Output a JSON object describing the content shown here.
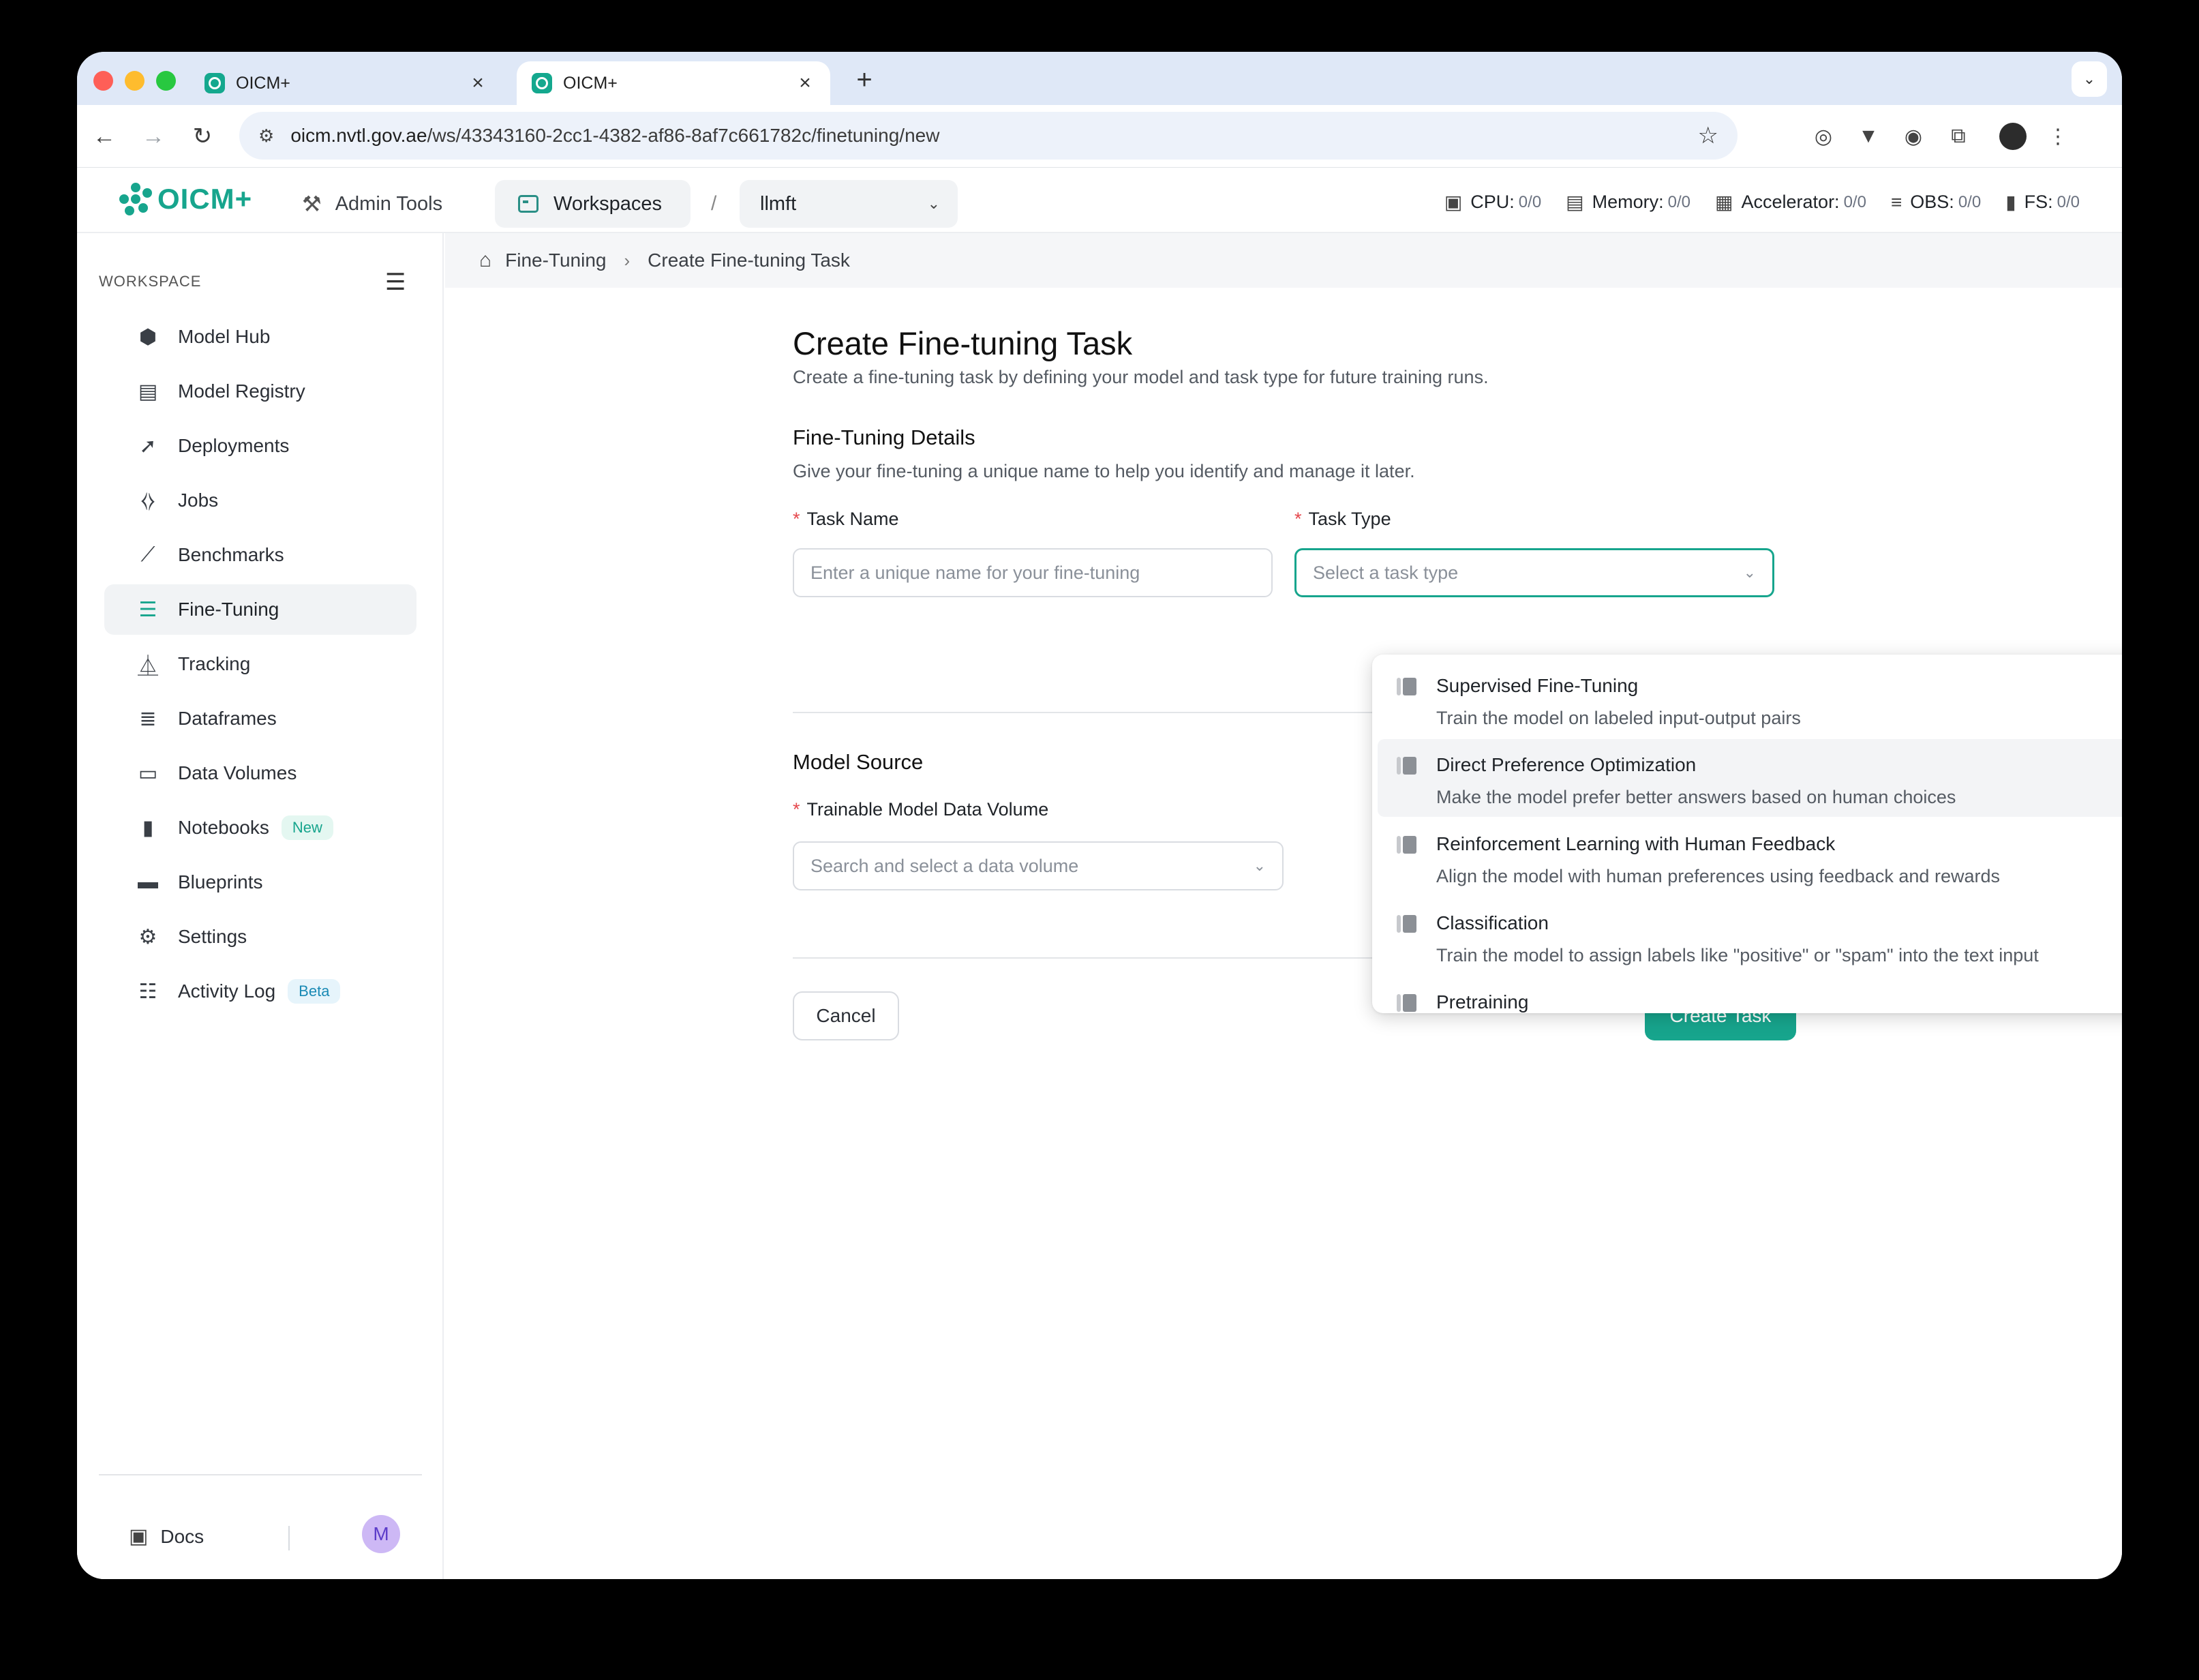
{
  "browser": {
    "tabs": [
      {
        "title": "OICM+",
        "active": false
      },
      {
        "title": "OICM+",
        "active": true
      }
    ],
    "url_host": "oicm.nvtl.gov.ae",
    "url_path": "/ws/43343160-2cc1-4382-af86-8af7c661782c/finetuning/new"
  },
  "header": {
    "logo_text": "OICM+",
    "admin_tools": "Admin Tools",
    "workspaces": "Workspaces",
    "separator": "/",
    "project": "llmft",
    "resources": [
      {
        "icon": "cpu-icon",
        "label": "CPU:",
        "value": "0/0"
      },
      {
        "icon": "memory-icon",
        "label": "Memory:",
        "value": "0/0"
      },
      {
        "icon": "accelerator-icon",
        "label": "Accelerator:",
        "value": "0/0"
      },
      {
        "icon": "obs-icon",
        "label": "OBS:",
        "value": "0/0"
      },
      {
        "icon": "fs-icon",
        "label": "FS:",
        "value": "0/0"
      }
    ]
  },
  "sidebar": {
    "section_label": "WORKSPACE",
    "items": [
      {
        "label": "Model Hub",
        "icon": "cube-icon"
      },
      {
        "label": "Model Registry",
        "icon": "registry-icon"
      },
      {
        "label": "Deployments",
        "icon": "rocket-icon"
      },
      {
        "label": "Jobs",
        "icon": "code-icon"
      },
      {
        "label": "Benchmarks",
        "icon": "benchmark-icon"
      },
      {
        "label": "Fine-Tuning",
        "icon": "sliders-icon",
        "active": true
      },
      {
        "label": "Tracking",
        "icon": "flask-icon"
      },
      {
        "label": "Dataframes",
        "icon": "database-icon"
      },
      {
        "label": "Data Volumes",
        "icon": "volumes-icon"
      },
      {
        "label": "Notebooks",
        "icon": "notebook-icon",
        "badge": "New"
      },
      {
        "label": "Blueprints",
        "icon": "blueprint-icon"
      },
      {
        "label": "Settings",
        "icon": "gear-icon"
      },
      {
        "label": "Activity Log",
        "icon": "list-icon",
        "badge": "Beta"
      }
    ],
    "docs": "Docs",
    "avatar_initial": "M"
  },
  "breadcrumb": {
    "parent": "Fine-Tuning",
    "current": "Create Fine-tuning Task"
  },
  "form": {
    "title": "Create Fine-tuning Task",
    "subtitle": "Create a fine-tuning task by defining your model and task type for future training runs.",
    "details_title": "Fine-Tuning Details",
    "details_subtitle": "Give your fine-tuning a unique name to help you identify and manage it later.",
    "required_mark": "*",
    "task_name_label": "Task Name",
    "task_name_placeholder": "Enter a unique name for your fine-tuning",
    "task_type_label": "Task Type",
    "task_type_placeholder": "Select a task type",
    "model_source_title": "Model Source",
    "volume_label": "Trainable Model Data Volume",
    "volume_placeholder": "Search and select a data volume",
    "cancel": "Cancel",
    "create": "Create Task"
  },
  "task_type_options": [
    {
      "title": "Supervised Fine-Tuning",
      "desc": "Train the model on labeled input-output pairs"
    },
    {
      "title": "Direct Preference Optimization",
      "desc": "Make the model prefer better answers based on human choices",
      "hover": true
    },
    {
      "title": "Reinforcement Learning with Human Feedback",
      "desc": "Align the model with human preferences using feedback and rewards"
    },
    {
      "title": "Classification",
      "desc": "Train the model to assign labels like \"positive\" or \"spam\" into the text input"
    },
    {
      "title": "Pretraining",
      "desc": ""
    }
  ],
  "colors": {
    "brand": "#17a58d",
    "required": "#e5484d",
    "badge_beta": "#1a8ab5"
  }
}
